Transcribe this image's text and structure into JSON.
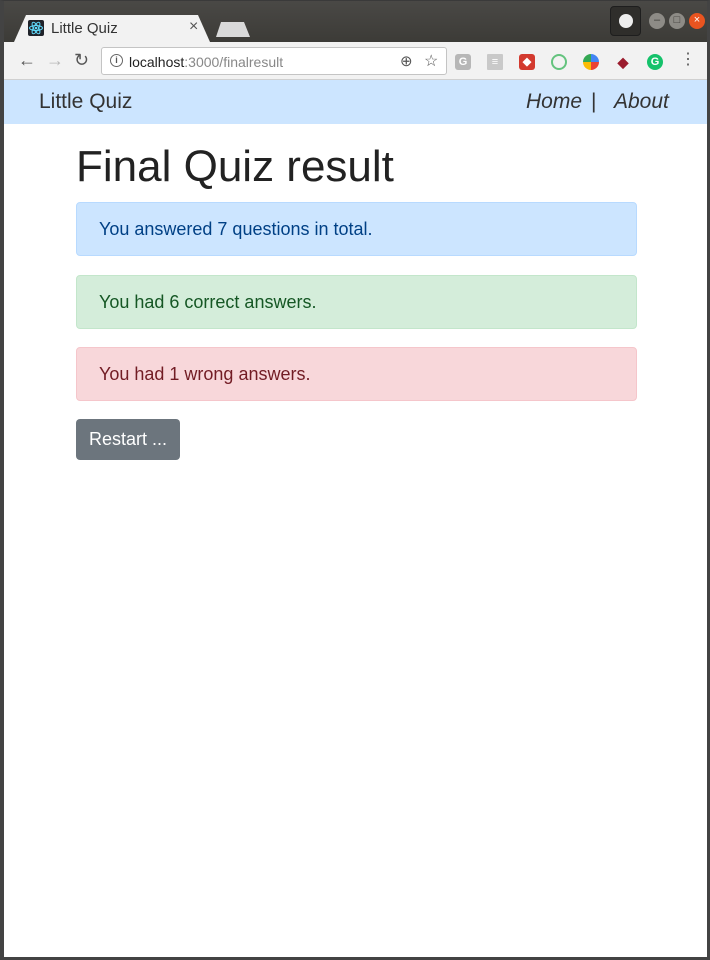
{
  "browser": {
    "tab_title": "Little Quiz",
    "tab_close": "×",
    "url_host": "localhost",
    "url_path": ":3000/finalresult"
  },
  "navbar": {
    "brand": "Little Quiz",
    "home": "Home",
    "separator": "|",
    "about": "About"
  },
  "main": {
    "title": "Final Quiz result",
    "total_text": "You answered 7 questions in total.",
    "correct_text": "You had 6 correct answers.",
    "wrong_text": "You had 1 wrong answers.",
    "restart_label": "Restart ..."
  },
  "colors": {
    "info_bg": "#cce5ff",
    "success_bg": "#d4edda",
    "danger_bg": "#f8d7da",
    "button_bg": "#6c757d"
  }
}
